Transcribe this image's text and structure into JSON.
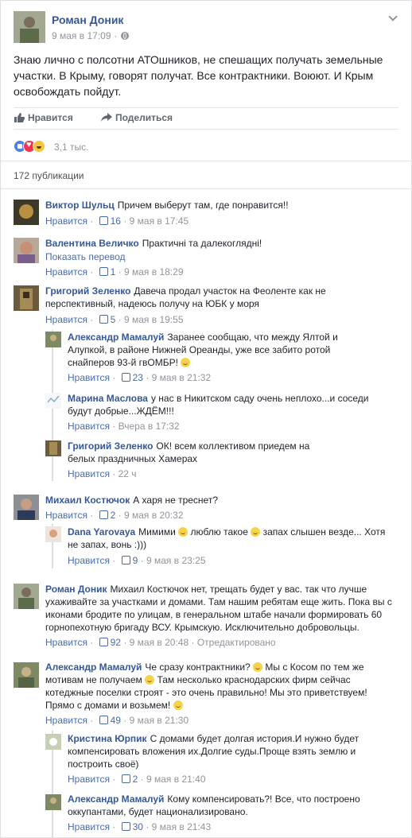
{
  "post": {
    "author": "Роман Доник",
    "date": "9 мая в 17:09",
    "dot": "·",
    "text": "Знаю лично с полсотни АТОшников, не спешащих получать земельные участки. В Крыму, говорят получат. Все контрактники. Воюют. И Крым освобождать пойдут.",
    "like_label": "Нравится",
    "share_label": "Поделиться",
    "reactions_count": "3,1 тыс.",
    "publications": "172 публикации"
  },
  "comments": [
    {
      "author": "Виктор Шульц",
      "text": "Причем выберут там, где понравится!!",
      "like": "Нравится",
      "likes": "16",
      "time": "9 мая в 17:45"
    },
    {
      "author": "Валентина Величко",
      "text": "Практичні та далекоглядні!",
      "translate": "Показать перевод",
      "like": "Нравится",
      "likes": "1",
      "time": "9 мая в 18:29"
    },
    {
      "author": "Григорий Зеленко",
      "text": "Давеча продал участок на Феоленте как не перспективный, надеюсь получу на ЮБК у моря",
      "like": "Нравится",
      "likes": "5",
      "time": "9 мая в 19:55"
    },
    {
      "author": "Александр Мамалуй",
      "text": "Заранее сообщаю, что между Ялтой и Алупкой, в районе Нижней Ореанды, уже все забито ротой снайперов 93-й гвОМБР!",
      "like": "Нравится",
      "likes": "23",
      "time": "9 мая в 21:32"
    },
    {
      "author": "Марина Маслова",
      "text": "у нас в Никитском саду очень неплохо...и соседи будут добрые...ЖДЁМ!!!",
      "like": "Нравится",
      "time": "Вчера в 17:32"
    },
    {
      "author": "Григорий Зеленко",
      "text": "ОК! всем коллективом приедем на белых праздничных Хамерах",
      "like": "Нравится",
      "time": "22 ч"
    },
    {
      "author": "Михаил Костючок",
      "text": "А харя не треснет?",
      "like": "Нравится",
      "likes": "2",
      "time": "9 мая в 20:32"
    },
    {
      "author": "Dana Yarovaya",
      "text_a": "Мимими",
      "text_b": "люблю такое",
      "text_c": "запах слышен везде... Хотя не запах, вонь :)))",
      "like": "Нравится",
      "likes": "9",
      "time": "9 мая в 23:25"
    },
    {
      "author": "Роман Доник",
      "mention": "Михаил Костючок",
      "text": "нет, трещать будет у вас. так что лучше ухаживайте за участками и домами. Там нашим ребятам еще жить. Пока вы с иконами бродите по улицам, в генеральном штабе начали формировать 60 горнопехотную бригаду ВСУ. Крымскую. Исключительно добровольцы.",
      "like": "Нравится",
      "likes": "92",
      "time": "9 мая в 20:48",
      "edited": "Отредактировано"
    },
    {
      "author": "Александр Мамалуй",
      "text_a": "Че сразу контрактники?",
      "text_b": "Мы с Косом по тем же мотивам не получаем",
      "text_c": "Там несколько краснодарских фирм сейчас котеджные поселки строят - это очень правильно! Мы это приветствуем! Прямо с домами и возьмем!",
      "like": "Нравится",
      "likes": "49",
      "time": "9 мая в 21:30"
    },
    {
      "author": "Кристина Юрпик",
      "text": "С домами будет долгая история.И нужно будет компенсировать вложения их.Долгие суды.Проще взять землю и построить своё)",
      "like": "Нравится",
      "likes": "2",
      "time": "9 мая в 21:40"
    },
    {
      "author": "Александр Мамалуй",
      "text": "Кому компенсировать?! Все, что построено оккупантами, будет национализировано.",
      "like": "Нравится",
      "likes": "30",
      "time": "9 мая в 21:43"
    }
  ]
}
